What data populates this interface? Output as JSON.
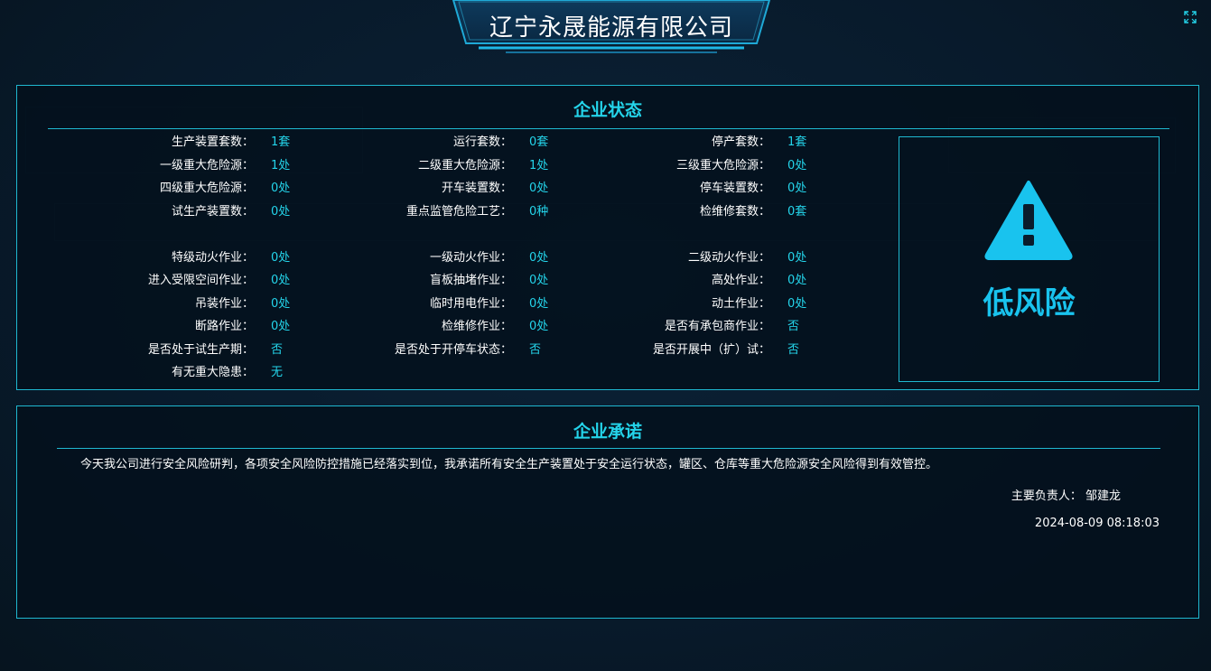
{
  "header": {
    "title": "辽宁永晟能源有限公司"
  },
  "status_panel": {
    "title": "企业状态",
    "col1": [
      {
        "label": "生产装置套数：",
        "value": "1套"
      },
      {
        "label": "一级重大危险源：",
        "value": "1处"
      },
      {
        "label": "四级重大危险源：",
        "value": "0处"
      },
      {
        "label": "试生产装置数：",
        "value": "0处"
      },
      {
        "label": "特级动火作业：",
        "value": "0处"
      },
      {
        "label": "进入受限空间作业：",
        "value": "0处"
      },
      {
        "label": "吊装作业：",
        "value": "0处"
      },
      {
        "label": "断路作业：",
        "value": "0处"
      },
      {
        "label": "是否处于试生产期：",
        "value": "否"
      },
      {
        "label": "有无重大隐患：",
        "value": "无"
      }
    ],
    "col2": [
      {
        "label": "运行套数：",
        "value": "0套"
      },
      {
        "label": "二级重大危险源：",
        "value": "1处"
      },
      {
        "label": "开车装置数：",
        "value": "0处"
      },
      {
        "label": "重点监管危险工艺：",
        "value": "0种"
      },
      {
        "label": "一级动火作业：",
        "value": "0处"
      },
      {
        "label": "盲板抽堵作业：",
        "value": "0处"
      },
      {
        "label": "临时用电作业：",
        "value": "0处"
      },
      {
        "label": "检维修作业：",
        "value": "0处"
      },
      {
        "label": "是否处于开停车状态：",
        "value": "否"
      }
    ],
    "col3": [
      {
        "label": "停产套数：",
        "value": "1套"
      },
      {
        "label": "三级重大危险源：",
        "value": "0处"
      },
      {
        "label": "停车装置数：",
        "value": "0处"
      },
      {
        "label": "检维修套数：",
        "value": "0套"
      },
      {
        "label": "二级动火作业：",
        "value": "0处"
      },
      {
        "label": "高处作业：",
        "value": "0处"
      },
      {
        "label": "动土作业：",
        "value": "0处"
      },
      {
        "label": "是否有承包商作业：",
        "value": "否"
      },
      {
        "label": "是否开展中（扩）试：",
        "value": "否"
      }
    ],
    "risk": {
      "level": "低风险",
      "icon": "warning-triangle-icon",
      "color": "#19c3ee"
    }
  },
  "promise_panel": {
    "title": "企业承诺",
    "text": "今天我公司进行安全风险研判，各项安全风险防控措施已经落实到位，我承诺所有安全生产装置处于安全运行状态，罐区、仓库等重大危险源安全风险得到有效管控。",
    "signer_label": "主要负责人：",
    "signer_name": "邹建龙",
    "timestamp": "2024-08-09 08:18:03"
  },
  "colors": {
    "accent": "#24d4ea",
    "border": "#1fb8d0",
    "background": "#081a2b"
  }
}
